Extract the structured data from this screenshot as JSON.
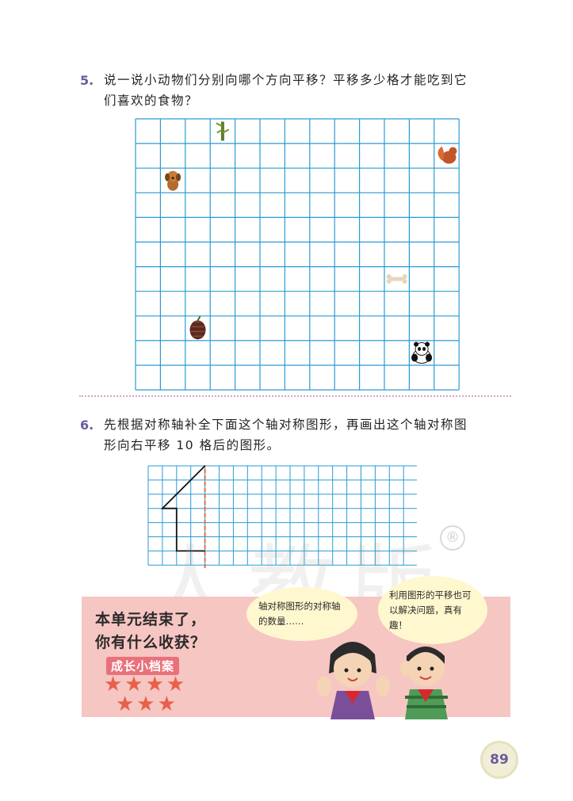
{
  "problem5": {
    "number": "5.",
    "line1": "说一说小动物们分别向哪个方向平移？平移多少格才能吃到它",
    "line2": "们喜欢的食物？"
  },
  "grid1": {
    "cols": 13,
    "rows": 11,
    "line_color": "#2a9bd3",
    "items": [
      {
        "name": "bamboo-icon",
        "col": 3,
        "row": 0
      },
      {
        "name": "squirrel-icon",
        "col": 12,
        "row": 1
      },
      {
        "name": "dog-icon",
        "col": 1,
        "row": 2
      },
      {
        "name": "bone-icon",
        "col": 10,
        "row": 6
      },
      {
        "name": "pinecone-icon",
        "col": 2,
        "row": 8
      },
      {
        "name": "panda-icon",
        "col": 11,
        "row": 9
      }
    ]
  },
  "problem6": {
    "number": "6.",
    "line1": "先根据对称轴补全下面这个轴对称图形，再画出这个轴对称图",
    "line2": "形向右平移 10 格后的图形。"
  },
  "grid2": {
    "cols": 19,
    "rows": 7,
    "line_color": "#2a9bd3",
    "axis_color": "#e8703a",
    "axis_col": 4,
    "half_figure": [
      [
        4,
        0
      ],
      [
        1,
        3
      ],
      [
        2,
        3
      ],
      [
        2,
        6
      ],
      [
        4,
        6
      ]
    ]
  },
  "banner": {
    "line1": "本单元结束了，",
    "line2": "你有什么收获？",
    "archive": "成长小档案",
    "stars_row1": "★★★★",
    "stars_row2": "★★★",
    "bubble_left": "轴对称图形的对称轴的数量……",
    "bubble_right": "利用图形的平移也可以解决问题，真有趣！",
    "background": "#f6c6c3"
  },
  "page_number": "89"
}
